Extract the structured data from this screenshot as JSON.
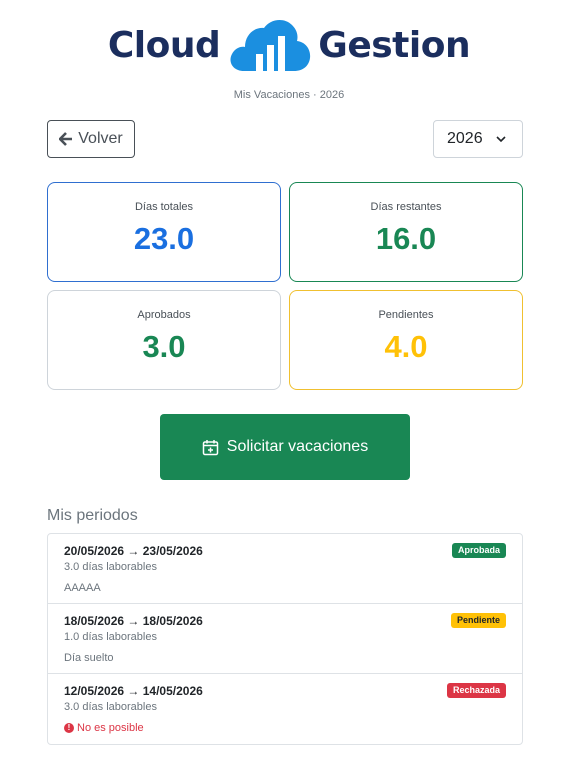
{
  "header": {
    "logo_left": "Cloud",
    "logo_right": "Gestion",
    "subtitle": "Mis Vacaciones · 2026"
  },
  "toolbar": {
    "back_label": "Volver",
    "year_selected": "2026"
  },
  "stats": [
    {
      "label": "Días totales",
      "value": "23.0",
      "color": "#1a6fe0"
    },
    {
      "label": "Días restantes",
      "value": "16.0",
      "color": "#198754"
    },
    {
      "label": "Aprobados",
      "value": "3.0",
      "color": "#198754"
    },
    {
      "label": "Pendientes",
      "value": "4.0",
      "color": "#ffc107"
    }
  ],
  "request_button": {
    "label": "Solicitar vacaciones"
  },
  "section_title": "Mis periodos",
  "periods": [
    {
      "dates": "20/05/2026 → 23/05/2026",
      "days": "3.0 días laborables",
      "note": "AAAAA",
      "status": "Aprobada"
    },
    {
      "dates": "18/05/2026 → 18/05/2026",
      "days": "1.0 días laborables",
      "note": "Día suelto",
      "status": "Pendiente"
    },
    {
      "dates": "12/05/2026 → 14/05/2026",
      "days": "3.0 días laborables",
      "note": "No es posible",
      "status": "Rechazada"
    }
  ],
  "colors": {
    "brand_navy": "#1b2e5e",
    "brand_blue": "#1b8fe0",
    "success": "#198754",
    "warning": "#ffc107",
    "danger": "#dc3545"
  }
}
